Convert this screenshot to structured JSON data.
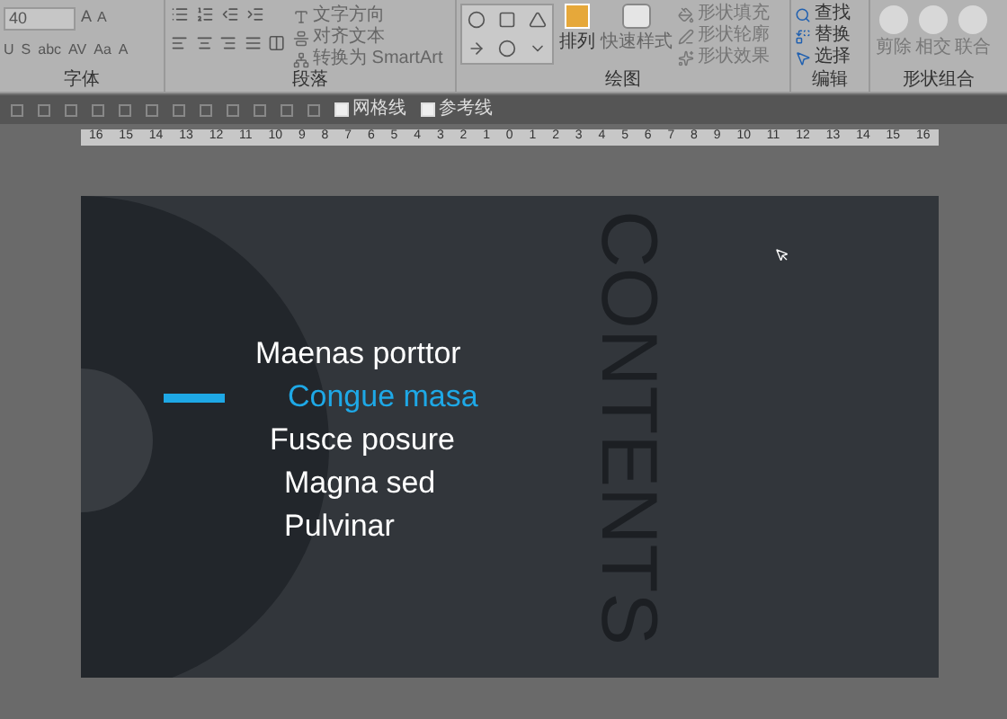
{
  "ribbon": {
    "font": {
      "label": "字体",
      "size": "40",
      "grow": "A",
      "shrink": "A",
      "buttons": [
        "U",
        "S",
        "abc",
        "AV",
        "Aa",
        "A"
      ]
    },
    "paragraph": {
      "label": "段落",
      "commands": [
        "文字方向",
        "对齐文本",
        "转换为 SmartArt"
      ]
    },
    "drawing": {
      "label": "绘图",
      "arrange": "排列",
      "quick_styles": "快速样式",
      "commands": [
        "形状填充",
        "形状轮廓",
        "形状效果"
      ]
    },
    "editing": {
      "label": "编辑",
      "commands": [
        "查找",
        "替换",
        "选择"
      ]
    },
    "merge": {
      "label": "形状组合",
      "commands": [
        "剪除",
        "相交",
        "联合"
      ]
    }
  },
  "toolbar": {
    "checkboxes": [
      {
        "label": "网格线",
        "checked": false
      },
      {
        "label": "参考线",
        "checked": false
      }
    ]
  },
  "ruler": [
    "16",
    "15",
    "14",
    "13",
    "12",
    "11",
    "10",
    "9",
    "8",
    "7",
    "6",
    "5",
    "4",
    "3",
    "2",
    "1",
    "0",
    "1",
    "2",
    "3",
    "4",
    "5",
    "6",
    "7",
    "8",
    "9",
    "10",
    "11",
    "12",
    "13",
    "14",
    "15",
    "16"
  ],
  "slide": {
    "title": "CONTENTS",
    "items": [
      {
        "label": "Maenas porttor",
        "selected": false
      },
      {
        "label": "Congue masa",
        "selected": true
      },
      {
        "label": "Fusce posure",
        "selected": false
      },
      {
        "label": "Magna sed",
        "selected": false
      },
      {
        "label": "Pulvinar",
        "selected": false
      }
    ]
  }
}
